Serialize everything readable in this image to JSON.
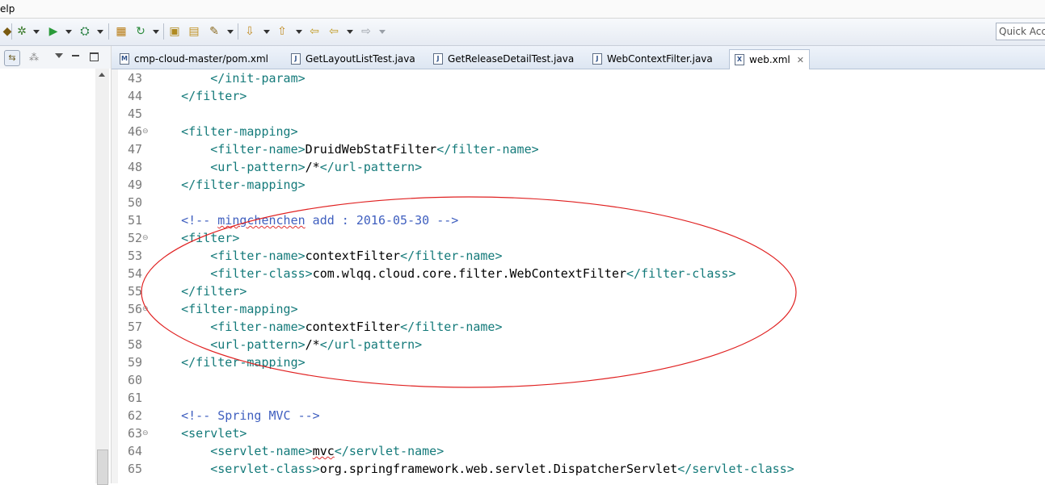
{
  "menu": {
    "partial_label": "elp"
  },
  "toolbar": {
    "quick_access_placeholder": "Quick Acc",
    "icons": [
      "debug-icon",
      "run-icon",
      "external-tools-icon",
      "new-package-icon",
      "refresh-icon",
      "open-folder-icon",
      "open-type-icon",
      "search-icon",
      "next-annotation-icon",
      "prev-annotation-icon",
      "back-icon",
      "forward-icon"
    ]
  },
  "tabs": [
    {
      "label": "cmp-cloud-master/pom.xml",
      "icon": "M"
    },
    {
      "label": "GetLayoutListTest.java",
      "icon": "J"
    },
    {
      "label": "GetReleaseDetailTest.java",
      "icon": "J"
    },
    {
      "label": "WebContextFilter.java",
      "icon": "J"
    },
    {
      "label": "web.xml",
      "icon": "X",
      "active": true
    }
  ],
  "editor": {
    "lines": [
      {
        "n": "43",
        "fold": false,
        "indent": "        ",
        "parts": [
          [
            "tag",
            "</init-param>"
          ]
        ]
      },
      {
        "n": "44",
        "fold": false,
        "indent": "    ",
        "parts": [
          [
            "tag",
            "</filter>"
          ]
        ]
      },
      {
        "n": "45",
        "fold": false,
        "indent": "",
        "parts": []
      },
      {
        "n": "46",
        "fold": true,
        "indent": "    ",
        "parts": [
          [
            "tag",
            "<filter-mapping>"
          ]
        ]
      },
      {
        "n": "47",
        "fold": false,
        "indent": "        ",
        "parts": [
          [
            "tag",
            "<filter-name>"
          ],
          [
            "txt",
            "DruidWebStatFilter"
          ],
          [
            "tag",
            "</filter-name>"
          ]
        ]
      },
      {
        "n": "48",
        "fold": false,
        "indent": "        ",
        "parts": [
          [
            "tag",
            "<url-pattern>"
          ],
          [
            "txt",
            "/*"
          ],
          [
            "tag",
            "</url-pattern>"
          ]
        ]
      },
      {
        "n": "49",
        "fold": false,
        "indent": "    ",
        "parts": [
          [
            "tag",
            "</filter-mapping>"
          ]
        ]
      },
      {
        "n": "50",
        "fold": false,
        "indent": "",
        "parts": []
      },
      {
        "n": "51",
        "fold": false,
        "indent": "    ",
        "parts": [
          [
            "cmt",
            "<!-- "
          ],
          [
            "cmtsq",
            "mingchenchen"
          ],
          [
            "cmt",
            " add : 2016-05-30 -->"
          ]
        ]
      },
      {
        "n": "52",
        "fold": true,
        "indent": "    ",
        "parts": [
          [
            "tag",
            "<filter>"
          ]
        ]
      },
      {
        "n": "53",
        "fold": false,
        "indent": "        ",
        "parts": [
          [
            "tag",
            "<filter-name>"
          ],
          [
            "txt",
            "contextFilter"
          ],
          [
            "tag",
            "</filter-name>"
          ]
        ]
      },
      {
        "n": "54",
        "fold": false,
        "indent": "        ",
        "parts": [
          [
            "tag",
            "<filter-class>"
          ],
          [
            "txt",
            "com.wlqq.cloud.core.filter.WebContextFilter"
          ],
          [
            "tag",
            "</filter-class>"
          ]
        ]
      },
      {
        "n": "55",
        "fold": false,
        "indent": "    ",
        "parts": [
          [
            "tag",
            "</filter>"
          ]
        ]
      },
      {
        "n": "56",
        "fold": true,
        "indent": "    ",
        "parts": [
          [
            "tag",
            "<filter-mapping>"
          ]
        ]
      },
      {
        "n": "57",
        "fold": false,
        "indent": "        ",
        "parts": [
          [
            "tag",
            "<filter-name>"
          ],
          [
            "txt",
            "contextFilter"
          ],
          [
            "tag",
            "</filter-name>"
          ]
        ]
      },
      {
        "n": "58",
        "fold": false,
        "indent": "        ",
        "parts": [
          [
            "tag",
            "<url-pattern>"
          ],
          [
            "txt",
            "/*"
          ],
          [
            "tag",
            "</url-pattern>"
          ]
        ]
      },
      {
        "n": "59",
        "fold": false,
        "indent": "    ",
        "parts": [
          [
            "tag",
            "</filter-mapping>"
          ]
        ]
      },
      {
        "n": "60",
        "fold": false,
        "indent": "",
        "parts": []
      },
      {
        "n": "61",
        "fold": false,
        "indent": "",
        "parts": []
      },
      {
        "n": "62",
        "fold": false,
        "indent": "    ",
        "parts": [
          [
            "cmt",
            "<!-- Spring MVC -->"
          ]
        ]
      },
      {
        "n": "63",
        "fold": true,
        "indent": "    ",
        "parts": [
          [
            "tag",
            "<servlet>"
          ]
        ]
      },
      {
        "n": "64",
        "fold": false,
        "indent": "        ",
        "parts": [
          [
            "tag",
            "<servlet-name>"
          ],
          [
            "txtsq",
            "mvc"
          ],
          [
            "tag",
            "</servlet-name>"
          ]
        ]
      },
      {
        "n": "65",
        "fold": false,
        "indent": "        ",
        "parts": [
          [
            "tag",
            "<servlet-class>"
          ],
          [
            "txt",
            "org.springframework.web.servlet.DispatcherServlet"
          ],
          [
            "tag",
            "</servlet-class>"
          ]
        ]
      }
    ]
  },
  "colors": {
    "tag": "#147a7a",
    "comment": "#3f5fbf",
    "annotation": "#e02020"
  }
}
